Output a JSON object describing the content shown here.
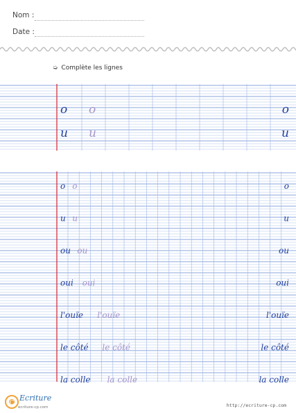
{
  "header": {
    "name_label": "Nom :",
    "date_label": "Date :"
  },
  "instruction": {
    "arrow": "➭",
    "text": "Complète les lignes"
  },
  "colors": {
    "model": "#1f3f9e",
    "trace": "#a695c9",
    "margin_line": "#d6212f",
    "ruling": "#a9c0e8",
    "major_ruling": "#8aa4dc",
    "vertical": "#9fb6e4"
  },
  "block1": {
    "rows": [
      {
        "model": "o",
        "trace": "o",
        "end": "o"
      },
      {
        "model": "u",
        "trace": "u",
        "end": "u"
      }
    ]
  },
  "block2": {
    "rows": [
      {
        "model": "o",
        "trace": "o",
        "end": "o"
      },
      {
        "model": "u",
        "trace": "u",
        "end": "u"
      },
      {
        "model": "ou",
        "trace": "ou",
        "end": "ou"
      },
      {
        "model": "oui",
        "trace": "oui",
        "end": "oui"
      },
      {
        "model": "l'ouïe",
        "trace": "l'ouïe",
        "end": "l'ouïe"
      },
      {
        "model": "le côté",
        "trace": "le côté",
        "end": "le côté"
      },
      {
        "model": "la colle",
        "trace": "la colle",
        "end": "la colle"
      }
    ]
  },
  "footer": {
    "logo_letter": "C",
    "logo_text": "Ecriture",
    "logo_sub": "ecriture-cp.com",
    "url": "http://ecriture-cp.com"
  }
}
